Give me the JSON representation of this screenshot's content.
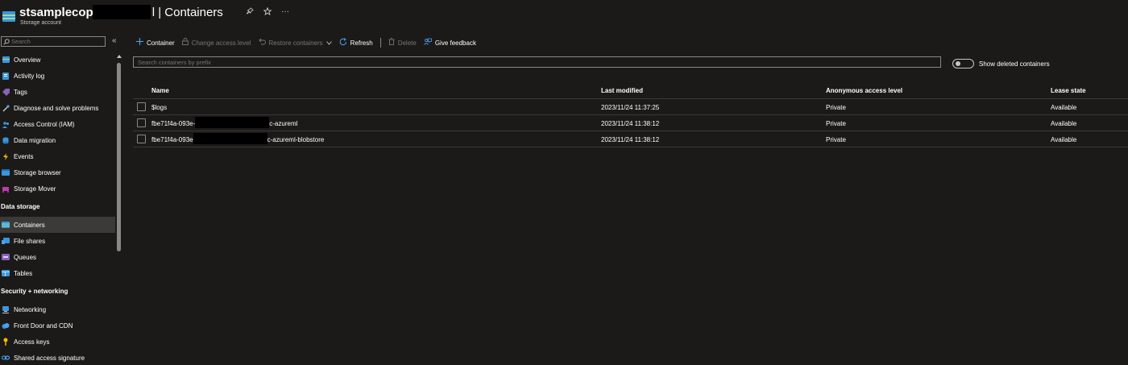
{
  "header": {
    "resource_name": "stsamplecop",
    "resource_suffix": "l | Containers",
    "resource_type": "Storage account",
    "pin_icon": "pin-icon",
    "star_icon": "star-icon",
    "more_label": "···"
  },
  "sidebar": {
    "search_placeholder": "Search",
    "collapse_label": "«",
    "items": [
      {
        "label": "Overview",
        "icon": "overview-icon",
        "color": "#3a96dd"
      },
      {
        "label": "Activity log",
        "icon": "activity-log-icon",
        "color": "#3a96dd"
      },
      {
        "label": "Tags",
        "icon": "tag-icon",
        "color": "#8764b8"
      },
      {
        "label": "Diagnose and solve problems",
        "icon": "wrench-icon",
        "color": "#4f9ff0"
      },
      {
        "label": "Access Control (IAM)",
        "icon": "people-icon",
        "color": "#3a96dd"
      },
      {
        "label": "Data migration",
        "icon": "data-migration-icon",
        "color": "#3a96dd"
      },
      {
        "label": "Events",
        "icon": "lightning-icon",
        "color": "#ffb900"
      },
      {
        "label": "Storage browser",
        "icon": "storage-browser-icon",
        "color": "#3a96dd"
      },
      {
        "label": "Storage Mover",
        "icon": "storage-mover-icon",
        "color": "#c239b3"
      }
    ],
    "data_storage_header": "Data storage",
    "data_storage_items": [
      {
        "label": "Containers",
        "icon": "container-icon",
        "color": "#3a96dd"
      },
      {
        "label": "File shares",
        "icon": "file-share-icon",
        "color": "#3a96dd"
      },
      {
        "label": "Queues",
        "icon": "queue-icon",
        "color": "#8764b8"
      },
      {
        "label": "Tables",
        "icon": "table-icon",
        "color": "#3a96dd"
      }
    ],
    "security_header": "Security + networking",
    "security_items": [
      {
        "label": "Networking",
        "icon": "networking-icon",
        "color": "#3a96dd"
      },
      {
        "label": "Front Door and CDN",
        "icon": "cloud-icon",
        "color": "#3a96dd"
      },
      {
        "label": "Access keys",
        "icon": "key-icon",
        "color": "#ffb900"
      },
      {
        "label": "Shared access signature",
        "icon": "link-icon",
        "color": "#3a96dd"
      }
    ]
  },
  "toolbar": {
    "add_container": "Container",
    "change_access": "Change access level",
    "restore": "Restore containers",
    "refresh": "Refresh",
    "delete": "Delete",
    "feedback": "Give feedback"
  },
  "filter": {
    "placeholder": "Search containers by prefix",
    "toggle_label": "Show deleted containers"
  },
  "table": {
    "columns": [
      "Name",
      "Last modified",
      "Anonymous access level",
      "Lease state"
    ],
    "rows": [
      {
        "name_pre": "$logs",
        "name_post": "",
        "modified": "2023/11/24 11:37:25",
        "access": "Private",
        "lease": "Available"
      },
      {
        "name_pre": "fbe71f4a-093e-",
        "name_post": "c-azureml",
        "modified": "2023/11/24 11:38:12",
        "access": "Private",
        "lease": "Available"
      },
      {
        "name_pre": "fbe71f4a-093e",
        "name_post": "c-azureml-blobstore",
        "modified": "2023/11/24 11:38:12",
        "access": "Private",
        "lease": "Available"
      }
    ]
  }
}
